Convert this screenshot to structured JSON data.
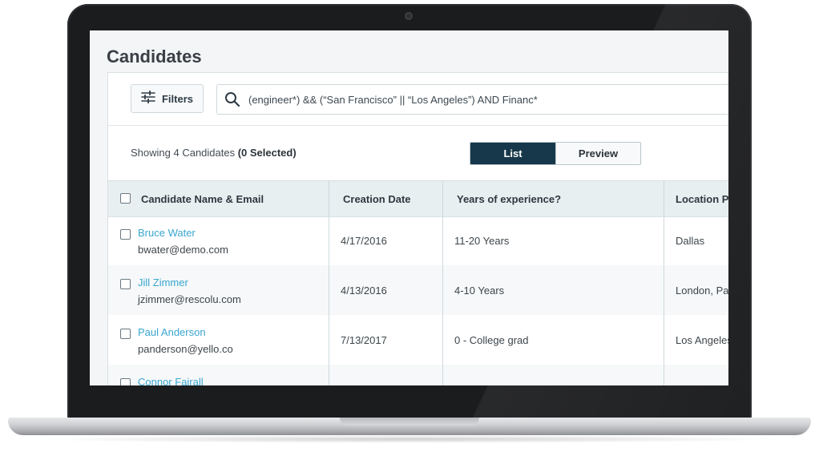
{
  "page": {
    "title": "Candidates"
  },
  "toolbar": {
    "filters_label": "Filters",
    "search_value": "(engineer*) && (“San Francisco” || “Los Angeles”) AND Financ*"
  },
  "summary": {
    "showing_text": "Showing 4 Candidates ",
    "selected_text": "(0 Selected)"
  },
  "view_toggle": {
    "options": [
      "List",
      "Preview"
    ],
    "active": "List"
  },
  "table": {
    "columns": [
      "Candidate Name & Email",
      "Creation Date",
      "Years of experience?",
      "Location Pre"
    ],
    "rows": [
      {
        "name": "Bruce Water",
        "email": "bwater@demo.com",
        "date": "4/17/2016",
        "experience": "11-20 Years",
        "location": "Dallas"
      },
      {
        "name": "Jill Zimmer",
        "email": "jzimmer@rescolu.com",
        "date": "4/13/2016",
        "experience": "4-10 Years",
        "location": "London, Par"
      },
      {
        "name": "Paul Anderson",
        "email": "panderson@yello.co",
        "date": "7/13/2017",
        "experience": "0 - College grad",
        "location": "Los Angeles"
      },
      {
        "name": "Connor Fairall",
        "email": "",
        "date": "",
        "experience": "",
        "location": ""
      }
    ]
  },
  "colors": {
    "accent_dark": "#17384a",
    "link": "#3aa6cf",
    "header_bg": "#e7eff1"
  },
  "icons": [
    "filter-sliders-icon",
    "search-icon",
    "checkbox-icon",
    "camera-icon"
  ]
}
